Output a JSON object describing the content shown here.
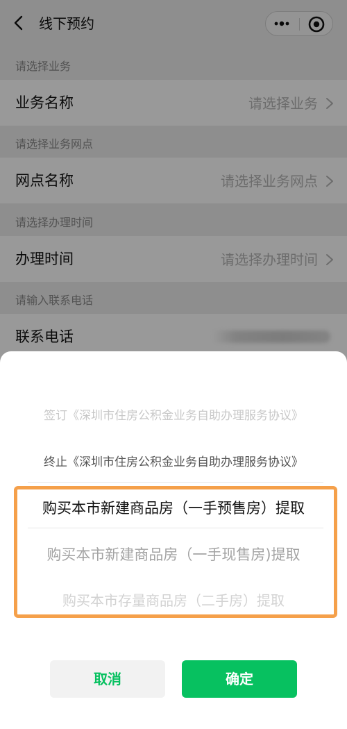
{
  "navbar": {
    "title": "线下预约",
    "back_icon": "chevron-left-icon",
    "more_icon": "more-dots-icon",
    "close_icon": "target-icon"
  },
  "form": {
    "sections": [
      {
        "label": "请选择业务",
        "field": "业务名称",
        "value": "请选择业务"
      },
      {
        "label": "请选择业务网点",
        "field": "网点名称",
        "value": "请选择业务网点"
      },
      {
        "label": "请选择办理时间",
        "field": "办理时间",
        "value": "请选择办理时间"
      },
      {
        "label": "请输入联系电话",
        "field": "联系电话",
        "value": ""
      }
    ]
  },
  "sheet": {
    "options": [
      {
        "text": "签订《深圳市住房公积金业务自助办理服务协议》",
        "state": "faded"
      },
      {
        "text": "终止《深圳市住房公积金业务自助办理服务协议》",
        "state": "normal"
      },
      {
        "text": "购买本市新建商品房（一手预售房）提取",
        "state": "selected"
      },
      {
        "text": "购买本市新建商品房（一手现售房)提取",
        "state": "faded"
      },
      {
        "text": "购买本市存量商品房（二手房）提取",
        "state": "faded"
      }
    ],
    "cancel_label": "取消",
    "confirm_label": "确定"
  },
  "colors": {
    "accent": "#07c160",
    "highlight": "#f5a04a"
  }
}
